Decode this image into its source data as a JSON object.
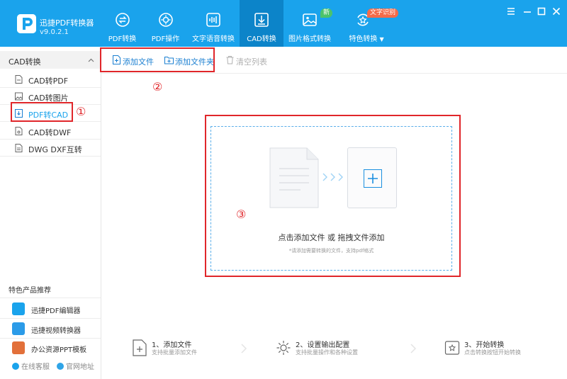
{
  "app": {
    "name": "迅捷PDF转换器",
    "version": "v9.0.2.1"
  },
  "nav": [
    {
      "label": "PDF转换",
      "icon": "swap-circle-icon"
    },
    {
      "label": "PDF操作",
      "icon": "gear-circle-icon"
    },
    {
      "label": "文字语音转换",
      "icon": "audio-wave-icon"
    },
    {
      "label": "CAD转换",
      "icon": "cad-download-icon",
      "active": true
    },
    {
      "label": "图片格式转换",
      "icon": "image-icon",
      "badge": "新"
    },
    {
      "label": "特色转换",
      "icon": "star-refresh-icon",
      "badge": "文字识别",
      "dropdown": "▼"
    }
  ],
  "sidebar": {
    "section_title": "CAD转换",
    "items": [
      {
        "label": "CAD转PDF"
      },
      {
        "label": "CAD转图片"
      },
      {
        "label": "PDF转CAD",
        "active": true
      },
      {
        "label": "CAD转DWF"
      },
      {
        "label": "DWG DXF互转"
      }
    ],
    "recommend_title": "特色产品推荐",
    "recommend": [
      {
        "label": "迅捷PDF编辑器"
      },
      {
        "label": "迅捷视频转换器"
      },
      {
        "label": "办公资源PPT模板"
      }
    ],
    "footer": {
      "service": "在线客服",
      "website": "官网地址"
    }
  },
  "toolbar": {
    "add_file": "添加文件",
    "add_folder": "添加文件夹",
    "clear_list": "清空列表"
  },
  "drop_zone": {
    "title": "点击添加文件 或 拖拽文件添加",
    "subtitle": "*请添加需要转换的文件，支持pdf格式"
  },
  "steps": [
    {
      "title": "1、添加文件",
      "desc": "支持批量添加文件"
    },
    {
      "title": "2、设置输出配置",
      "desc": "支持批量操作和各种设置"
    },
    {
      "title": "3、开始转换",
      "desc": "点击转换按钮开始转换"
    }
  ],
  "annotations": {
    "mark1": "①",
    "mark2": "②",
    "mark3": "③",
    "color": "#e0262a"
  },
  "colors": {
    "titlebar": "#1aa3ec",
    "nav_active": "#0c84c9",
    "accent_text": "#1a7fd1"
  }
}
